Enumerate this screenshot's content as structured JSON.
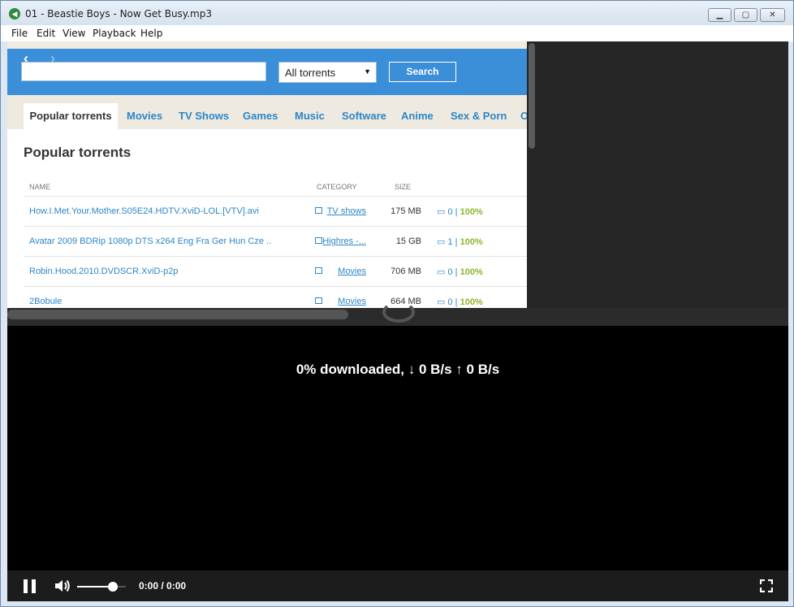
{
  "window": {
    "title": "01 - Beastie Boys - Now Get Busy.mp3",
    "app_icon": "app-logo-icon",
    "buttons": {
      "minimize": "▁",
      "maximize": "▢",
      "close": "✕"
    }
  },
  "menu": [
    "File",
    "Edit",
    "View",
    "Playback",
    "Help"
  ],
  "web": {
    "nav": {
      "back": "‹",
      "forward": "›"
    },
    "search": {
      "value": "",
      "placeholder": ""
    },
    "category_select": "All torrents",
    "search_button": "Search",
    "tabs": [
      "Popular torrents",
      "Movies",
      "TV Shows",
      "Games",
      "Music",
      "Software",
      "Anime",
      "Sex & Porn",
      "O"
    ],
    "heading": "Popular torrents",
    "columns": {
      "name": "NAME",
      "category": "CATEGORY",
      "size": "SIZE"
    },
    "rows": [
      {
        "name": "How.I.Met.Your.Mother.S05E24.HDTV.XviD-LOL.[VTV].avi",
        "category": "TV shows",
        "size": "175 MB",
        "comments": "0",
        "health": "100%"
      },
      {
        "name": "Avatar 2009 BDRip 1080p DTS x264 Eng Fra Ger Hun Cze ..",
        "category": "Highres -...",
        "size": "15 GB",
        "comments": "1",
        "health": "100%"
      },
      {
        "name": "Robin.Hood.2010.DVDSCR.XviD-p2p",
        "category": "Movies",
        "size": "706 MB",
        "comments": "0",
        "health": "100%"
      },
      {
        "name": "2Bobule",
        "category": "Movies",
        "size": "664 MB",
        "comments": "0",
        "health": "100%"
      }
    ]
  },
  "player": {
    "status": "0% downloaded, ↓ 0 B/s ↑ 0 B/s",
    "time": "0:00 / 0:00",
    "volume_fraction": 0.73,
    "state": "playing"
  },
  "colors": {
    "accent_blue": "#3b8fd9",
    "health_green": "#8ab82e",
    "player_bg": "#000000"
  }
}
